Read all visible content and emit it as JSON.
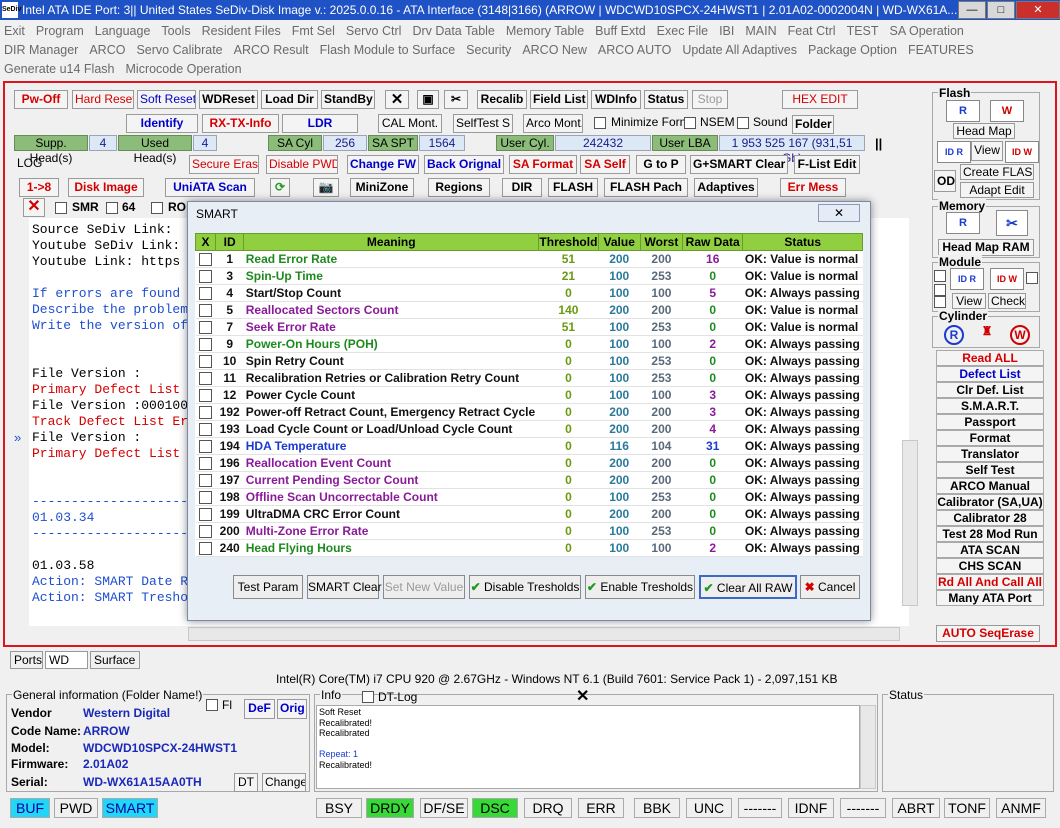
{
  "window": {
    "icon": "SeDiv",
    "title": "Intel ATA IDE  Port: 3|| United States  SeDiv-Disk Image v.: 2025.0.0.16 - ATA Interface (3148|3166)  (ARROW | WDCWD10SPCX-24HWST1 | 2.01A02-0002004N | WD-WX61A..."
  },
  "menu": [
    "Exit",
    "Program",
    "Language",
    "Tools",
    "Resident Files",
    "Fmt Sel",
    "Servo Ctrl",
    "Drv Data Table",
    "Memory Table",
    "Buff Extd",
    "Exec File",
    "IBI",
    "MAIN",
    "Feat Ctrl",
    "TEST",
    "SA Operation",
    "DIR Manager",
    "ARCO",
    "Servo Calibrate",
    "ARCO Result",
    "Flash Module to Surface",
    "Security",
    "ARCO New",
    "ARCO AUTO",
    "Update All Adaptives",
    "Package Option",
    "FEATURES",
    "Generate u14 Flash",
    "Microcode Operation"
  ],
  "toolbar": {
    "pw_off": "Pw-Off",
    "hard_reset": "Hard Reset",
    "soft_reset": "Soft Reset",
    "wdreset": "WDReset",
    "load_dir": "Load Dir",
    "standby": "StandBy",
    "close_x": "✕",
    "save": "▣",
    "tools": "✂",
    "recalib": "Recalib",
    "field_list": "Field List",
    "wdinfo": "WDInfo",
    "status": "Status",
    "stop": "Stop",
    "hex_edit": "HEX EDIT",
    "identify": "Identify",
    "rx_tx_info": "RX-TX-Info",
    "ldr": "LDR",
    "cal_mont": "CAL Mont.",
    "selftest_s": "SelfTest S",
    "arco_mont": "Arco Mont.",
    "minimize_form": "Minimize Form",
    "nsem": "NSEM",
    "sound": "Sound",
    "folder": "Folder",
    "supp_heads_label": "Supp. Head(s)",
    "supp_heads_val": "4",
    "used_heads_label": "Used Head(s)",
    "used_heads_val": "4",
    "sa_cyl_label": "SA Cyl",
    "sa_cyl_val": "256",
    "sa_spt_label": "SA SPT",
    "sa_spt_val": "1564",
    "user_cyl_label": "User Cyl.",
    "user_cyl_val": "242432",
    "user_lba_label": "User LBA",
    "user_lba_val": "1 953 525 167  (931,51 Gb)",
    "pause": "||",
    "log_tab": "LOG",
    "secure_erase": "Secure Erase",
    "disable_pwd": "Disable PWD",
    "change_fw": "Change FW",
    "back_orignal": "Back Orignal",
    "sa_format": "SA Format",
    "sa_self": "SA Self",
    "g_to_p": "G to P",
    "g_smart_clear": "G+SMART Clear",
    "f_list_edit": "F-List Edit",
    "one_to_8": "1->8",
    "disk_image": "Disk Image",
    "uniata_scan": "UniATA Scan",
    "refresh": "⟳",
    "camera": "📷",
    "minizone": "MiniZone",
    "regions": "Regions",
    "dir": "DIR",
    "flash": "FLASH",
    "flash_pach": "FLASH Pach",
    "adaptives": "Adaptives",
    "err_mess": "Err Mess",
    "smr": "SMR",
    "sixty_four": "64",
    "ro": "RO"
  },
  "log": {
    "lines": [
      {
        "t": "Source SeDiv Link: ",
        "c": "k"
      },
      {
        "t": "Youtube SeDiv Link: ",
        "c": "k"
      },
      {
        "t": "Youtube Link: https",
        "c": "k"
      },
      {
        "t": "If errors are found",
        "c": "blue"
      },
      {
        "t": "Describe the problem",
        "c": "blue"
      },
      {
        "t": "Write the version of",
        "c": "blue"
      },
      {
        "t": "File Version :",
        "c": "k"
      },
      {
        "t": "Primary Defect List",
        "c": "red"
      },
      {
        "t": "File Version :000100",
        "c": "k"
      },
      {
        "t": "Track Defect List Er",
        "c": "red"
      },
      {
        "t": "File Version :",
        "c": "k"
      },
      {
        "t": "Primary Defect List",
        "c": "red"
      },
      {
        "t": "--------------------",
        "c": "blue"
      },
      {
        "t": "01.03.34",
        "c": "blue"
      },
      {
        "t": "--------------------",
        "c": "blue"
      },
      {
        "t": "01.03.58",
        "c": "k"
      },
      {
        "t": "Action: SMART Date R",
        "c": "blue"
      },
      {
        "t": "Action: SMART Treshol",
        "c": "blue"
      }
    ],
    "side_arrow": "»"
  },
  "right_panel": {
    "flash": "Flash",
    "head_map": "Head Map",
    "view": "View",
    "create_flash": "Create FLASH",
    "adapt_edit": "Adapt Edit",
    "od": "OD",
    "memory": "Memory",
    "head_map_ram": "Head Map RAM",
    "module": "Module",
    "view2": "View",
    "check": "Check",
    "cylinder": "Cylinder",
    "id_r": "ID R",
    "id_w": "ID W",
    "r_glyph": "R",
    "w_glyph": "W",
    "buttons": [
      {
        "label": "Read ALL",
        "color": "#d40000"
      },
      {
        "label": "Defect List",
        "color": "#0000c8"
      },
      {
        "label": "Clr Def. List",
        "color": "#000"
      },
      {
        "label": "S.M.A.R.T.",
        "color": "#000"
      },
      {
        "label": "Passport",
        "color": "#000"
      },
      {
        "label": "Format",
        "color": "#000"
      },
      {
        "label": "Translator",
        "color": "#000"
      },
      {
        "label": "Self Test",
        "color": "#000"
      },
      {
        "label": "ARCO Manual",
        "color": "#000"
      },
      {
        "label": "Calibrator (SA,UA)",
        "color": "#000"
      },
      {
        "label": "Calibrator 28",
        "color": "#000"
      },
      {
        "label": "Test 28 Mod Run",
        "color": "#000"
      },
      {
        "label": "ATA SCAN",
        "color": "#000"
      },
      {
        "label": "CHS SCAN",
        "color": "#000"
      },
      {
        "label": "Rd All And Call All",
        "color": "#d40000"
      },
      {
        "label": "Many ATA Port",
        "color": "#000"
      }
    ],
    "auto_seqerase": "AUTO SeqErase"
  },
  "smart": {
    "title": "SMART",
    "close": "✕",
    "headers": {
      "x": "X",
      "id": "ID",
      "meaning": "Meaning",
      "threshold": "Threshold",
      "value": "Value",
      "worst": "Worst",
      "raw": "Raw Data",
      "status": "Status"
    },
    "rows": [
      {
        "id": "1",
        "meaning": "Read Error Rate",
        "mc": "g",
        "th": "51",
        "val": "200",
        "wst": "200",
        "raw": "16",
        "rc": "pr",
        "st": "OK: Value is normal"
      },
      {
        "id": "3",
        "meaning": "Spin-Up Time",
        "mc": "g",
        "th": "21",
        "val": "100",
        "wst": "253",
        "raw": "0",
        "rc": "gr",
        "st": "OK: Value is normal"
      },
      {
        "id": "4",
        "meaning": "Start/Stop Count",
        "mc": "k",
        "th": "0",
        "val": "100",
        "wst": "100",
        "raw": "5",
        "rc": "pr",
        "st": "OK: Always passing"
      },
      {
        "id": "5",
        "meaning": "Reallocated Sectors Count",
        "mc": "p",
        "th": "140",
        "val": "200",
        "wst": "200",
        "raw": "0",
        "rc": "gr",
        "st": "OK: Value is normal"
      },
      {
        "id": "7",
        "meaning": "Seek Error Rate",
        "mc": "p",
        "th": "51",
        "val": "100",
        "wst": "253",
        "raw": "0",
        "rc": "gr",
        "st": "OK: Value is normal"
      },
      {
        "id": "9",
        "meaning": "Power-On Hours (POH)",
        "mc": "g",
        "th": "0",
        "val": "100",
        "wst": "100",
        "raw": "2",
        "rc": "pr",
        "st": "OK: Always passing"
      },
      {
        "id": "10",
        "meaning": "Spin Retry Count",
        "mc": "k",
        "th": "0",
        "val": "100",
        "wst": "253",
        "raw": "0",
        "rc": "gr",
        "st": "OK: Always passing"
      },
      {
        "id": "11",
        "meaning": "Recalibration Retries or Calibration Retry Count",
        "mc": "k",
        "th": "0",
        "val": "100",
        "wst": "253",
        "raw": "0",
        "rc": "gr",
        "st": "OK: Always passing"
      },
      {
        "id": "12",
        "meaning": "Power Cycle Count",
        "mc": "k",
        "th": "0",
        "val": "100",
        "wst": "100",
        "raw": "3",
        "rc": "pr",
        "st": "OK: Always passing"
      },
      {
        "id": "192",
        "meaning": "Power-off Retract Count, Emergency Retract Cycle",
        "mc": "k",
        "th": "0",
        "val": "200",
        "wst": "200",
        "raw": "3",
        "rc": "pr",
        "st": "OK: Always passing"
      },
      {
        "id": "193",
        "meaning": "Load Cycle Count or Load/Unload Cycle Count",
        "mc": "k",
        "th": "0",
        "val": "200",
        "wst": "200",
        "raw": "4",
        "rc": "pr",
        "st": "OK: Always passing"
      },
      {
        "id": "194",
        "meaning": "HDA Temperature",
        "mc": "b",
        "th": "0",
        "val": "116",
        "wst": "104",
        "raw": "31",
        "rc": "bl",
        "st": "OK: Always passing"
      },
      {
        "id": "196",
        "meaning": "Reallocation Event Count",
        "mc": "p",
        "th": "0",
        "val": "200",
        "wst": "200",
        "raw": "0",
        "rc": "gr",
        "st": "OK: Always passing"
      },
      {
        "id": "197",
        "meaning": "Current Pending Sector Count",
        "mc": "p",
        "th": "0",
        "val": "200",
        "wst": "200",
        "raw": "0",
        "rc": "gr",
        "st": "OK: Always passing"
      },
      {
        "id": "198",
        "meaning": "Offline Scan Uncorrectable Count",
        "mc": "p",
        "th": "0",
        "val": "100",
        "wst": "253",
        "raw": "0",
        "rc": "gr",
        "st": "OK: Always passing"
      },
      {
        "id": "199",
        "meaning": "UltraDMA CRC Error Count",
        "mc": "k",
        "th": "0",
        "val": "200",
        "wst": "200",
        "raw": "0",
        "rc": "gr",
        "st": "OK: Always passing"
      },
      {
        "id": "200",
        "meaning": "Multi-Zone Error Rate",
        "mc": "p",
        "th": "0",
        "val": "100",
        "wst": "253",
        "raw": "0",
        "rc": "gr",
        "st": "OK: Always passing"
      },
      {
        "id": "240",
        "meaning": "Head Flying Hours",
        "mc": "g",
        "th": "0",
        "val": "100",
        "wst": "100",
        "raw": "2",
        "rc": "pr",
        "st": "OK: Always passing"
      }
    ],
    "buttons": {
      "test_param": "Test Param",
      "smart_clear": "SMART Clear",
      "set_new_value": "Set New Value",
      "disable_tresholds": "Disable Tresholds",
      "enable_tresholds": "Enable Tresholds",
      "clear_all_raw": "Clear All RAW",
      "cancel": "Cancel"
    },
    "check_glyph": "✔",
    "cancel_glyph": "✖"
  },
  "tabs": [
    "Ports",
    "WD",
    "Surface"
  ],
  "cpu_line": "Intel(R) Core(TM) i7 CPU 920  @ 2.67GHz - Windows NT 6.1 (Build 7601: Service Pack 1) - 2,097,151 KB",
  "general": {
    "title": "General information (Folder Name!)",
    "fl": "Fl",
    "def": "DeF",
    "orig": "Orig",
    "vendor_label": "Vendor",
    "vendor": "Western Digital",
    "code_label": "Code Name:",
    "code": "ARROW",
    "model_label": "Model:",
    "model": "WDCWD10SPCX-24HWST1",
    "fw_label": "Firmware:",
    "fw": "2.01A02",
    "serial_label": "Serial:",
    "serial": "WD-WX61A15AA0TH",
    "dt": "DT",
    "change": "Change"
  },
  "info": {
    "title": "Info",
    "dt_log": "DT-Log",
    "close": "✕",
    "lines": [
      "Soft Reset",
      "Recalibrated!",
      "Recalibrated",
      "",
      "Repeat: 1",
      "Recalibrated!"
    ]
  },
  "status_box": {
    "title": "Status"
  },
  "status_bar": [
    {
      "label": "BUF",
      "style": "cyan"
    },
    {
      "label": "PWD",
      "style": ""
    },
    {
      "label": "SMART",
      "style": "cyan"
    },
    {
      "label": "BSY",
      "style": ""
    },
    {
      "label": "DRDY",
      "style": "green"
    },
    {
      "label": "DF/SE",
      "style": ""
    },
    {
      "label": "DSC",
      "style": "green"
    },
    {
      "label": "DRQ",
      "style": ""
    },
    {
      "label": "ERR",
      "style": ""
    },
    {
      "label": "BBK",
      "style": ""
    },
    {
      "label": "UNC",
      "style": ""
    },
    {
      "label": "-------",
      "style": ""
    },
    {
      "label": "IDNF",
      "style": ""
    },
    {
      "label": "-------",
      "style": ""
    },
    {
      "label": "ABRT",
      "style": ""
    },
    {
      "label": "TONF",
      "style": ""
    },
    {
      "label": "ANMF",
      "style": ""
    }
  ]
}
